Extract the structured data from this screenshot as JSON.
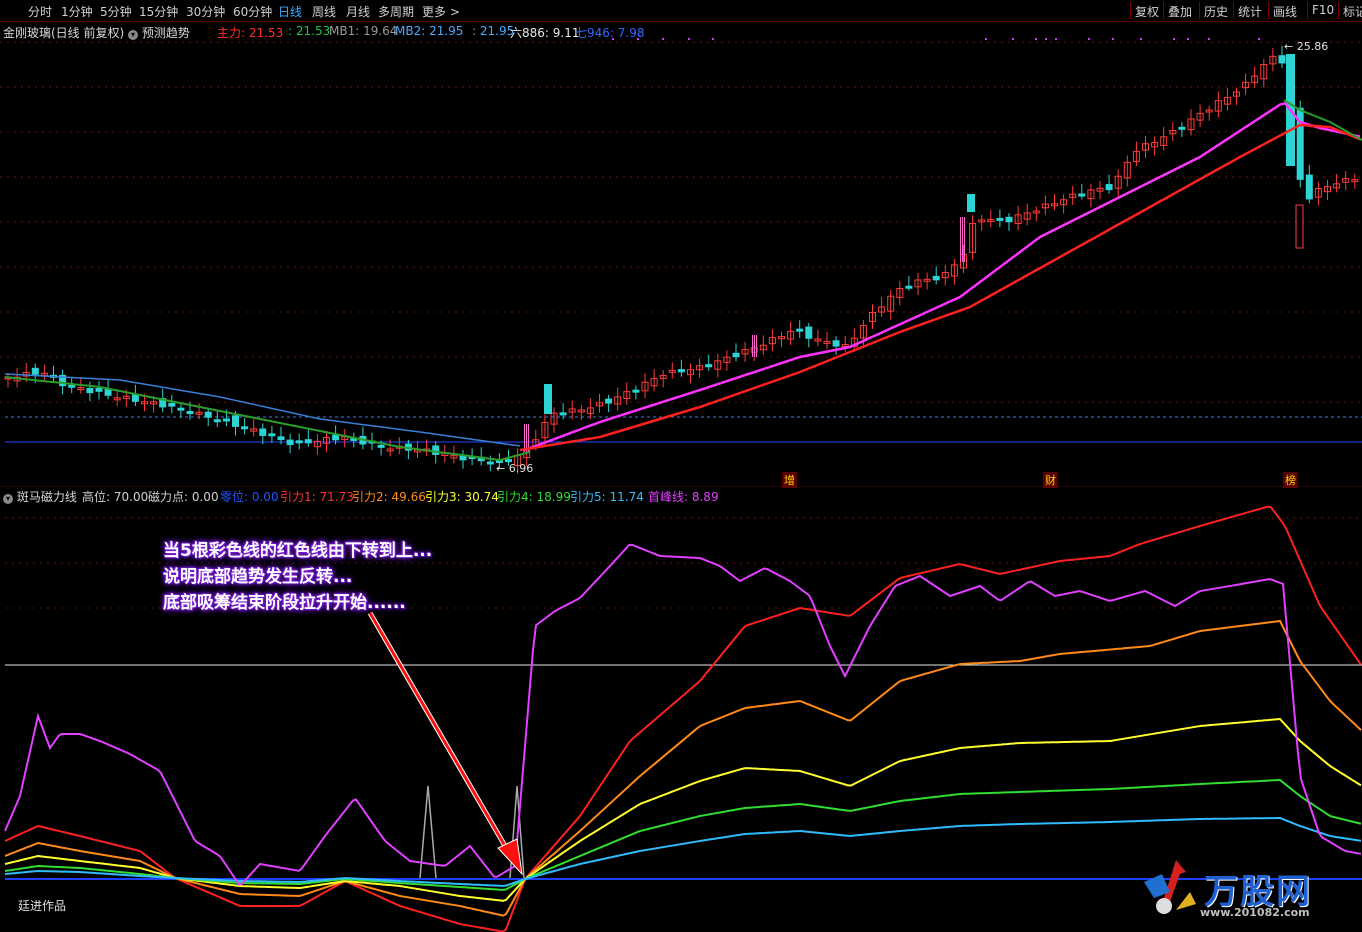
{
  "toolbar": {
    "periods": [
      "分时",
      "1分钟",
      "5分钟",
      "15分钟",
      "30分钟",
      "60分钟",
      "日线",
      "周线",
      "月线",
      "多周期",
      "更多 >"
    ],
    "active_period": "日线",
    "right_buttons": [
      "复权",
      "叠加",
      "历史",
      "统计",
      "画线",
      "F10",
      "标记"
    ]
  },
  "main_chart": {
    "title": "金刚玻璃(日线 前复权)",
    "trend_button": "预测趋势",
    "legend": [
      {
        "text": "主力: 21.53",
        "color": "#ff3030"
      },
      {
        "text": ": 21.53",
        "color": "#22c04a"
      },
      {
        "text": "MB1: 19.64",
        "color": "#9a9a9a"
      },
      {
        "text": "MB2: 21.95",
        "color": "#4aa8ff"
      },
      {
        "text": ": 21.95",
        "color": "#4aa8ff"
      },
      {
        "text": "六886: 9.11",
        "color": "#e8e8e8"
      },
      {
        "text": "七946: 7.98",
        "color": "#3366ff"
      }
    ],
    "high_label": "25.86",
    "low_label": "6.96",
    "flags": [
      "增",
      "财",
      "榜"
    ]
  },
  "indicator": {
    "title": "斑马磁力线",
    "legend": [
      {
        "text": "高位: 70.00",
        "color": "#d0d0d0"
      },
      {
        "text": "磁力点: 0.00",
        "color": "#d0d0d0"
      },
      {
        "text": "零位: 0.00",
        "color": "#2255ff"
      },
      {
        "text": "引力1: 71.73",
        "color": "#ff3030"
      },
      {
        "text": "引力2: 49.66",
        "color": "#ff8c1a"
      },
      {
        "text": "引力3: 30.74",
        "color": "#ffff33"
      },
      {
        "text": "引力4: 18.99",
        "color": "#33dd33"
      },
      {
        "text": "引力5: 11.74",
        "color": "#33bbff"
      },
      {
        "text": "首峰线: 8.89",
        "color": "#e040ff"
      }
    ],
    "annotation": [
      "当5根彩色线的红色线由下转到上...",
      "说明底部趋势发生反转...",
      "底部吸筹结束阶段拉升开始......"
    ],
    "author": "廷进作品"
  },
  "watermark": {
    "brand": "万股网",
    "url": "www.201082.com"
  },
  "colors": {
    "up": "#ff3b3b",
    "down": "#2ed3d3",
    "ma_magenta": "#ff33ff",
    "ma_red": "#ff2020",
    "ma_green": "#2a9d2a",
    "ma_blue": "#3a7fd6"
  },
  "chart_data": {
    "type": "candlestick",
    "price_range": [
      6.96,
      25.86
    ],
    "indicator_levels": {
      "high": 70,
      "zero": 0
    }
  }
}
